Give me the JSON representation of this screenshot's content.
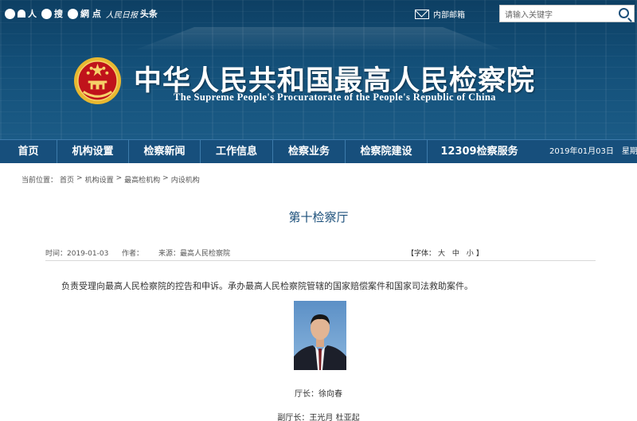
{
  "topbar": {
    "links": [
      {
        "label": "人",
        "icon": "weibo-icon"
      },
      {
        "label": "搜",
        "icon": "wechat-icon"
      },
      {
        "label": "網 点",
        "icon": "weblink-icon"
      },
      {
        "label": "头条",
        "icon": "people-daily-icon"
      }
    ],
    "mail_label": "内部邮箱",
    "search_placeholder": "请输入关键字"
  },
  "header": {
    "title_cn": "中华人民共和国最高人民检察院",
    "title_en": "The Supreme People's Procuratorate of the People's Republic of China"
  },
  "nav": {
    "items": [
      "首页",
      "机构设置",
      "检察新闻",
      "工作信息",
      "检察业务",
      "检察院建设",
      "12309检察服务"
    ],
    "date": "2019年01月03日",
    "weekday": "星期四"
  },
  "breadcrumb": {
    "prefix": "当前位置：",
    "items": [
      "首页",
      "机构设置",
      "最高检机构",
      "内设机构"
    ],
    "separator": ">"
  },
  "article": {
    "title": "第十检察厅",
    "meta": {
      "time": "时间：2019-01-03",
      "author": "作者：",
      "source": "来源：最高人民检察院"
    },
    "font_size": {
      "prefix": "【字体：",
      "sizes": [
        "大",
        "中",
        "小"
      ],
      "suffix": "】"
    },
    "body": "负责受理向最高人民检察院的控告和申诉。承办最高人民检察院管辖的国家赔偿案件和国家司法救助案件。",
    "caption_chief": "厅长：徐向春",
    "caption_deputy": "副厅长：王光月  杜亚起"
  },
  "colors": {
    "header_blue": "#134f78",
    "nav_blue": "#174f7c",
    "title_blue": "#1b4f7a",
    "emblem_red": "#c0131b",
    "emblem_gold": "#e8b830"
  }
}
